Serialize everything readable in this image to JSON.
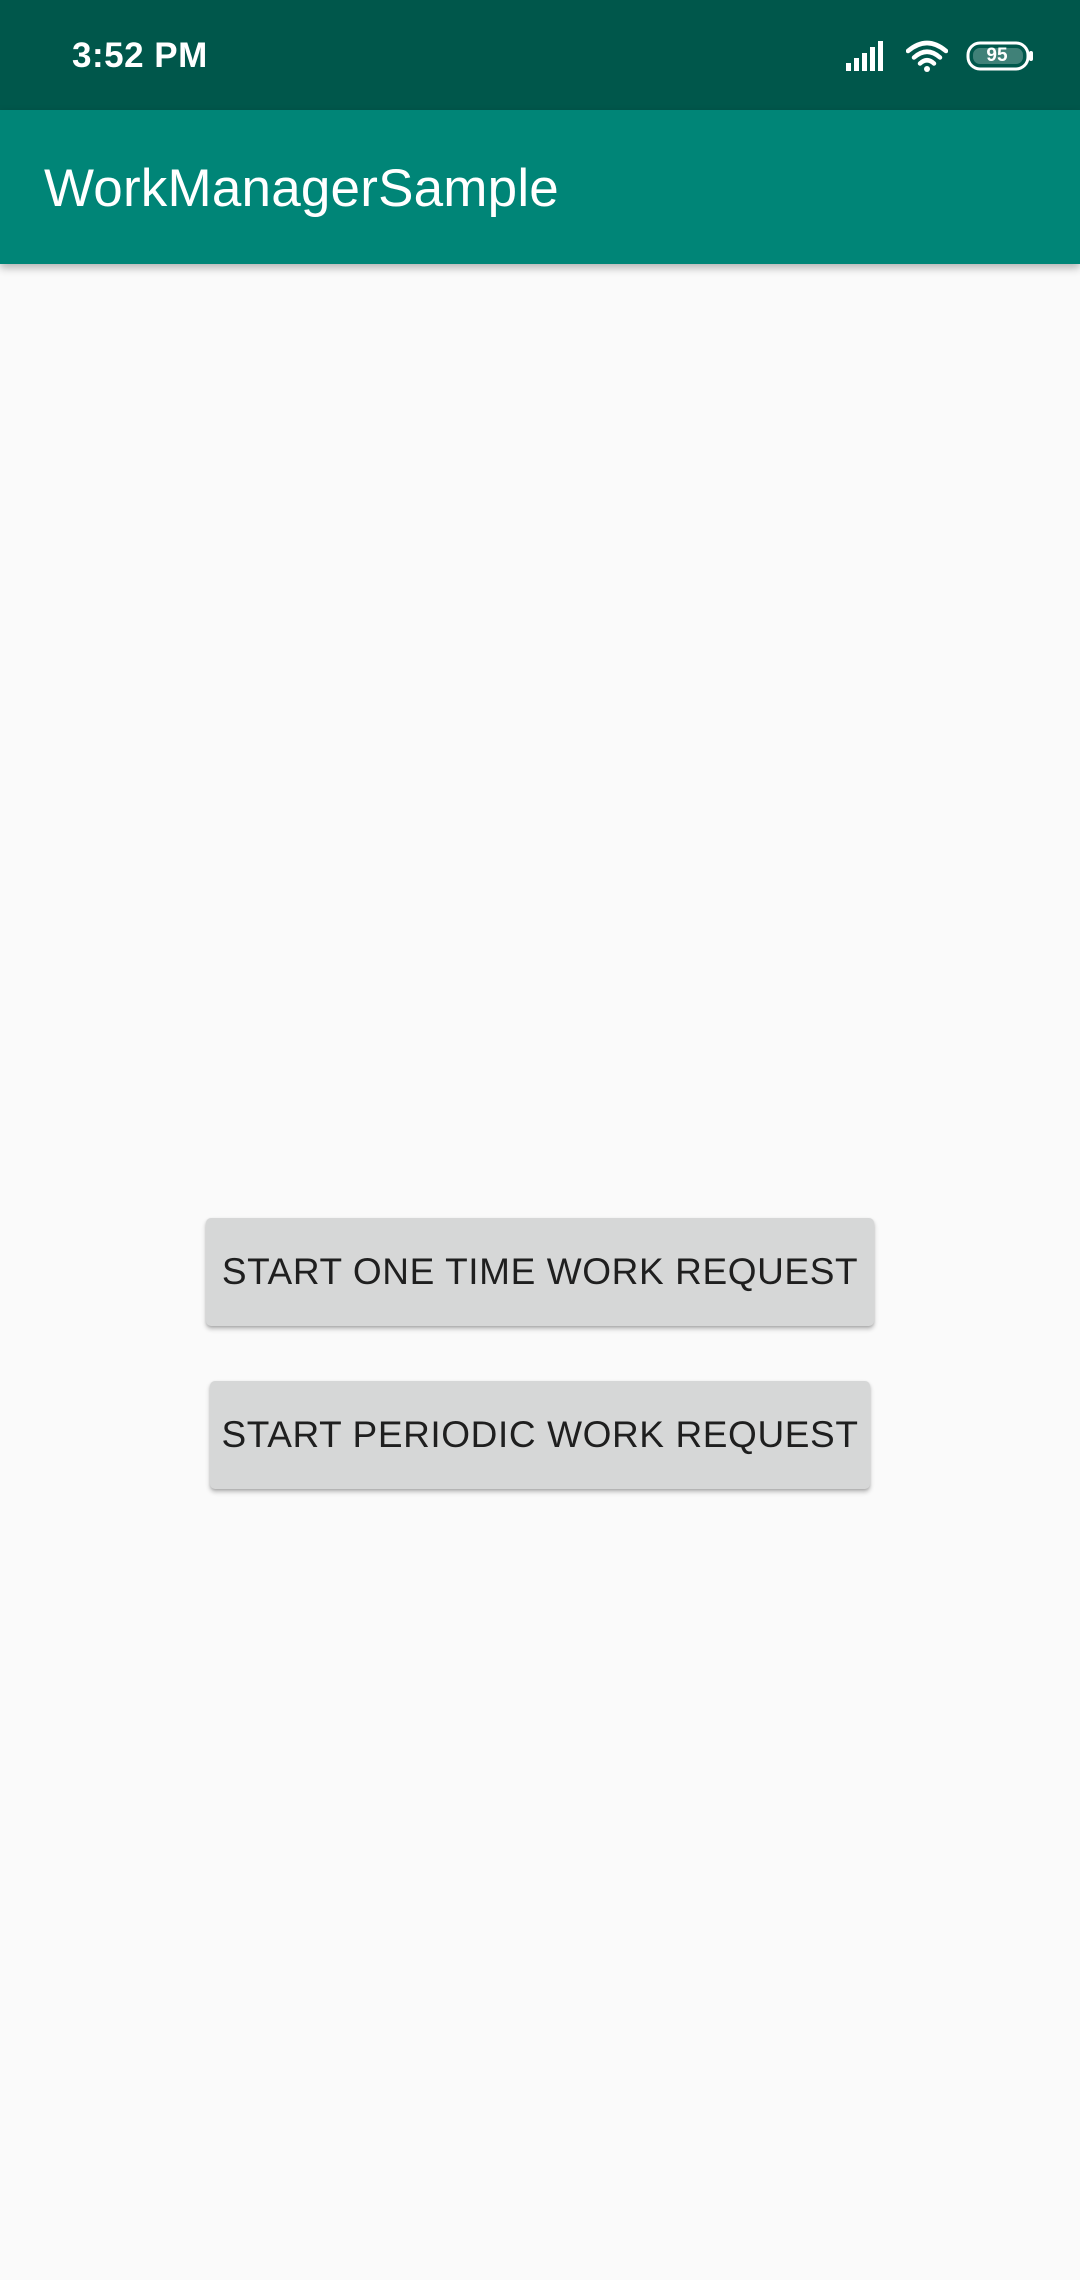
{
  "status_bar": {
    "time": "3:52 PM",
    "battery_level": "95",
    "signal_icon": "cellular-signal-icon",
    "wifi_icon": "wifi-icon",
    "battery_icon": "battery-icon"
  },
  "app_bar": {
    "title": "WorkManagerSample"
  },
  "main": {
    "one_time_button_label": "START ONE TIME WORK REQUEST",
    "periodic_button_label": "START PERIODIC WORK REQUEST"
  },
  "colors": {
    "status_bar": "#00574b",
    "app_bar": "#008577",
    "background": "#fafafa",
    "button": "#d6d7d7"
  }
}
